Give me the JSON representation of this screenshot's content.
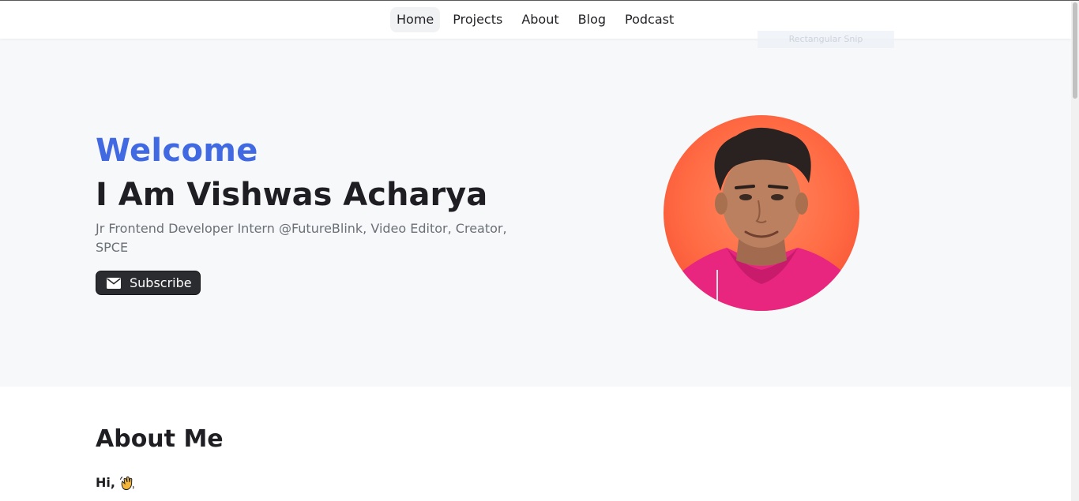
{
  "nav": {
    "items": [
      {
        "label": "Home",
        "active": true
      },
      {
        "label": "Projects"
      },
      {
        "label": "About"
      },
      {
        "label": "Blog"
      },
      {
        "label": "Podcast"
      }
    ]
  },
  "overlay": {
    "snip_label": "Rectangular Snip"
  },
  "hero": {
    "welcome": "Welcome",
    "name": "I Am Vishwas Acharya",
    "subtitle": "Jr Frontend Developer Intern @FutureBlink, Video Editor, Creator, SPCE",
    "subscribe_label": "Subscribe",
    "subscribe_icon": "mail-icon",
    "avatar": "profile-photo",
    "accent_color": "#4169e1"
  },
  "about": {
    "title": "About Me",
    "greeting": "Hi,",
    "greeting_icon": "waving-hand-icon"
  }
}
